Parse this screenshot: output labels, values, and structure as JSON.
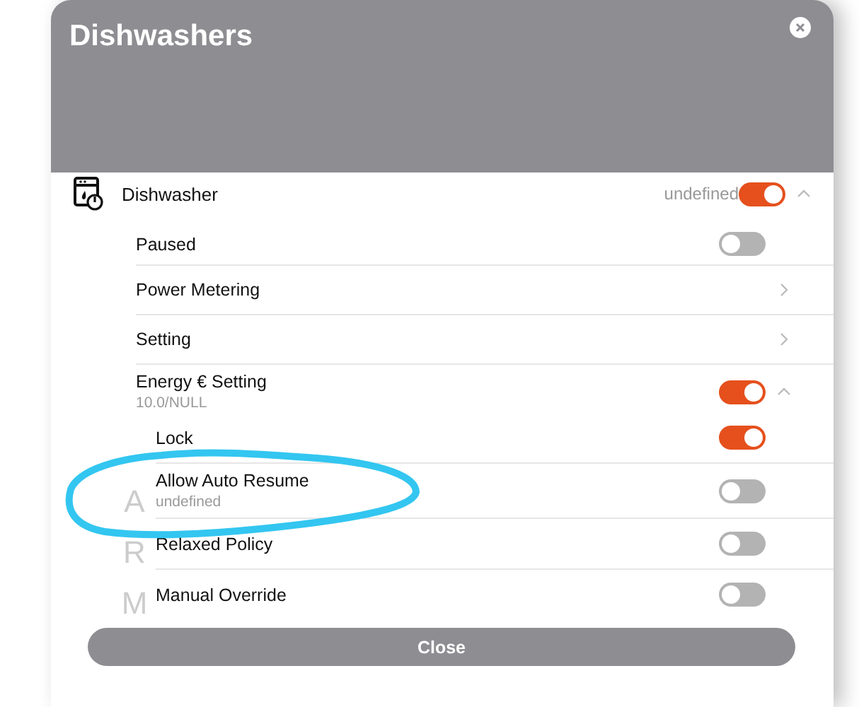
{
  "dialog": {
    "title": "Dishwashers",
    "device": {
      "name": "Dishwasher",
      "status": "undefined",
      "on": true,
      "expanded": true,
      "items": [
        {
          "kind": "toggle",
          "label": "Paused",
          "on": false
        },
        {
          "kind": "link",
          "label": "Power Metering"
        },
        {
          "kind": "link",
          "label": "Setting"
        },
        {
          "kind": "group",
          "label": "Energy € Setting",
          "subtitle": "10.0/NULL",
          "on": true,
          "expanded": true,
          "children": [
            {
              "label": "Lock",
              "on": true
            },
            {
              "label": "Allow Auto Resume",
              "subtitle": "undefined",
              "on": false,
              "index_letter": "A"
            },
            {
              "label": "Relaxed Policy",
              "on": false,
              "index_letter": "R"
            },
            {
              "label": "Manual Override",
              "on": false,
              "index_letter": "M"
            }
          ]
        }
      ]
    },
    "close_button": "Close"
  }
}
